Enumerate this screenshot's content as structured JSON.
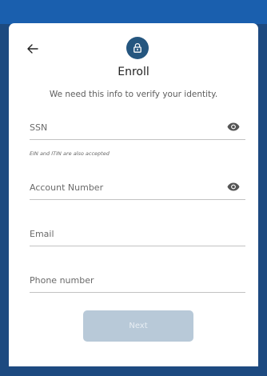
{
  "header": {
    "back_icon": "arrow-left-icon",
    "lock_icon": "lock-icon",
    "accent_color": "#25567f",
    "title": "Enroll",
    "subtitle": "We need this info to verify your identity."
  },
  "form": {
    "ssn": {
      "placeholder": "SSN",
      "value": "",
      "toggle_icon": "eye-icon",
      "helper": "EIN and ITIN are also accepted"
    },
    "account_number": {
      "placeholder": "Account Number",
      "value": "",
      "toggle_icon": "eye-icon"
    },
    "email": {
      "placeholder": "Email",
      "value": ""
    },
    "phone": {
      "placeholder": "Phone number",
      "value": ""
    }
  },
  "actions": {
    "next_label": "Next",
    "next_disabled": true
  }
}
